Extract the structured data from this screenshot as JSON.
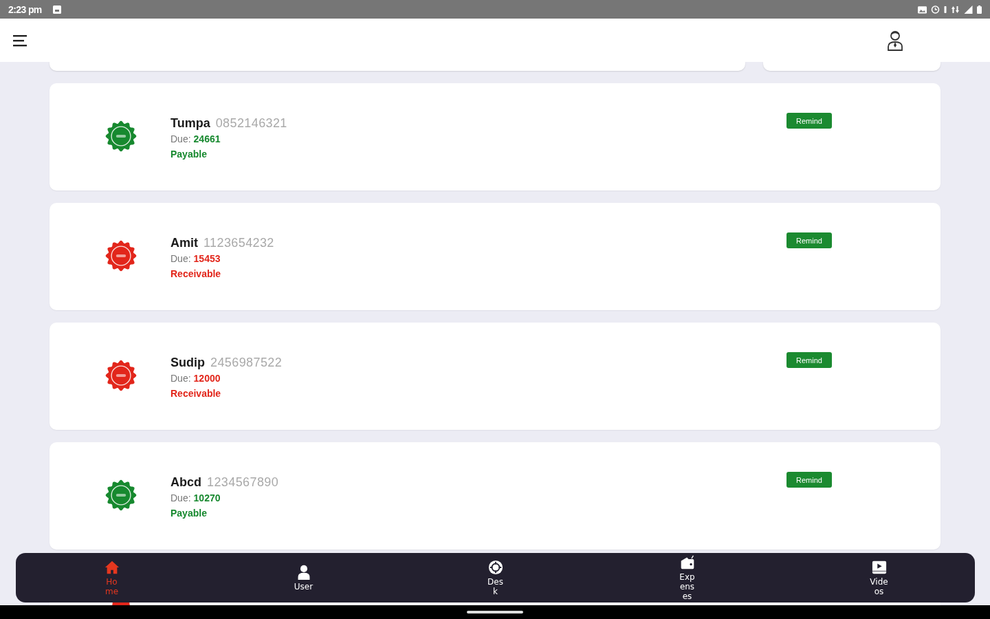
{
  "status_bar": {
    "time": "2:23 pm"
  },
  "entries": [
    {
      "name": "Tumpa",
      "phone": "0852146321",
      "due_label": "Due:",
      "due": "24661",
      "status": "Payable",
      "kind": "payable",
      "action": "Remind"
    },
    {
      "name": "Amit",
      "phone": "1123654232",
      "due_label": "Due:",
      "due": "15453",
      "status": "Receivable",
      "kind": "receivable",
      "action": "Remind"
    },
    {
      "name": "Sudip",
      "phone": "2456987522",
      "due_label": "Due:",
      "due": "12000",
      "status": "Receivable",
      "kind": "receivable",
      "action": "Remind"
    },
    {
      "name": "Abcd",
      "phone": "1234567890",
      "due_label": "Due:",
      "due": "10270",
      "status": "Payable",
      "kind": "payable",
      "action": "Remind"
    }
  ],
  "hidden_entry": {
    "kind": "receivable"
  },
  "bottom_nav": [
    {
      "label": "Home",
      "selected": true
    },
    {
      "label": "User",
      "selected": false
    },
    {
      "label": "Desk",
      "selected": false
    },
    {
      "label": "Expenses",
      "selected": false
    },
    {
      "label": "Videos",
      "selected": false
    }
  ]
}
